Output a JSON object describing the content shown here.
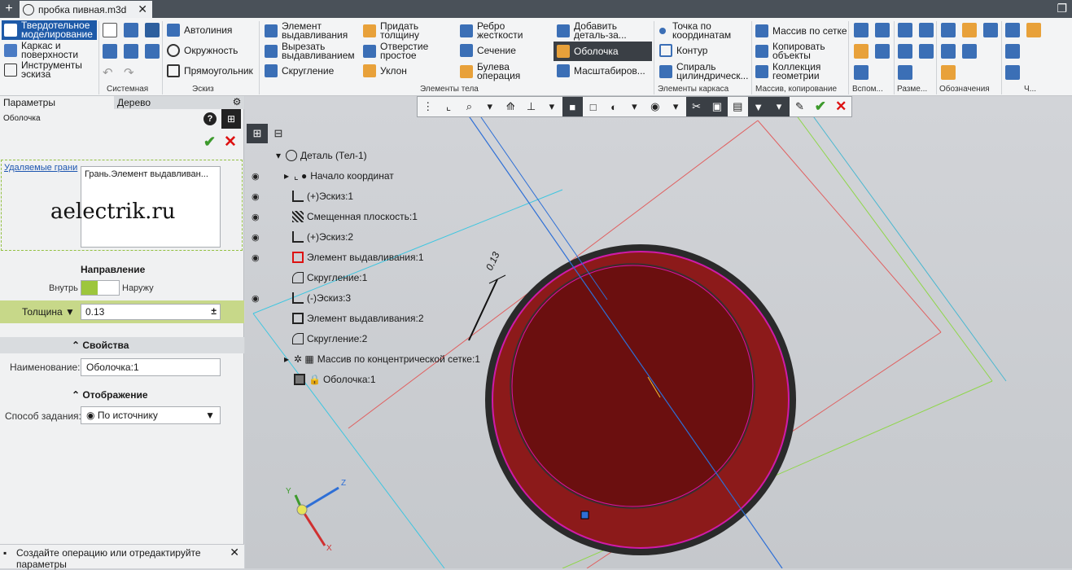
{
  "tabbar": {
    "doc_title": "пробка пивная.m3d"
  },
  "ribbon": {
    "mode_items": [
      "Твердотельное моделирование",
      "Каркас и поверхности",
      "Инструменты эскиза"
    ],
    "groups": {
      "system": "Системная",
      "sketch": "Эскиз",
      "body": "Элементы тела",
      "frame": "Элементы каркаса",
      "array": "Массив, копирование",
      "aux": "Вспом...",
      "dims": "Разме...",
      "marks": "Обозначения",
      "more": "Ч..."
    },
    "sketch_items": [
      "Автолиния",
      "Окружность",
      "Прямоугольник"
    ],
    "body_items": [
      "Элемент выдавливания",
      "Вырезать выдавливанием",
      "Скругление",
      "Придать толщину",
      "Отверстие простое",
      "Уклон",
      "Ребро жесткости",
      "Сечение",
      "Булева операция",
      "Добавить деталь-за...",
      "Оболочка",
      "Масштабиров..."
    ],
    "frame_items": [
      "Точка по координатам",
      "Контур",
      "Спираль цилиндрическ..."
    ],
    "array_items": [
      "Массив по сетке",
      "Копировать объекты",
      "Коллекция геометрии"
    ]
  },
  "panel": {
    "tab_params": "Параметры",
    "tab_tree": "Дерево",
    "operation": "Оболочка",
    "faces_link": "Удаляемые грани",
    "faces_value": "Грань.Элемент выдавливан...",
    "watermark": "aelectrik.ru",
    "direction_title": "Направление",
    "dir_inside": "Внутрь",
    "dir_outside": "Наружу",
    "thickness_label": "Толщина",
    "thickness_value": "0.13",
    "props_title": "Свойства",
    "name_label": "Наименование:",
    "name_value": "Оболочка:1",
    "display_title": "Отображение",
    "mode_label": "Способ задания:",
    "mode_value": "По источнику",
    "status": "Создайте операцию или отредактируйте параметры"
  },
  "tree": [
    "Деталь (Тел-1)",
    "Начало координат",
    "(+)Эскиз:1",
    "Смещенная плоскость:1",
    "(+)Эскиз:2",
    "Элемент выдавливания:1",
    "Скругление:1",
    "(-)Эскиз:3",
    "Элемент выдавливания:2",
    "Скругление:2",
    "Массив по концентрической сетке:1",
    "Оболочка:1"
  ],
  "viewport": {
    "dim_label": "0.13",
    "axis_x": "X",
    "axis_y": "Y",
    "axis_z": "Z"
  },
  "colors": {
    "accent": "#1e5aa8",
    "ok": "#3d9a2c",
    "cancel": "#d11111",
    "model": "#6b0f0f",
    "highlight": "#c7d889"
  }
}
